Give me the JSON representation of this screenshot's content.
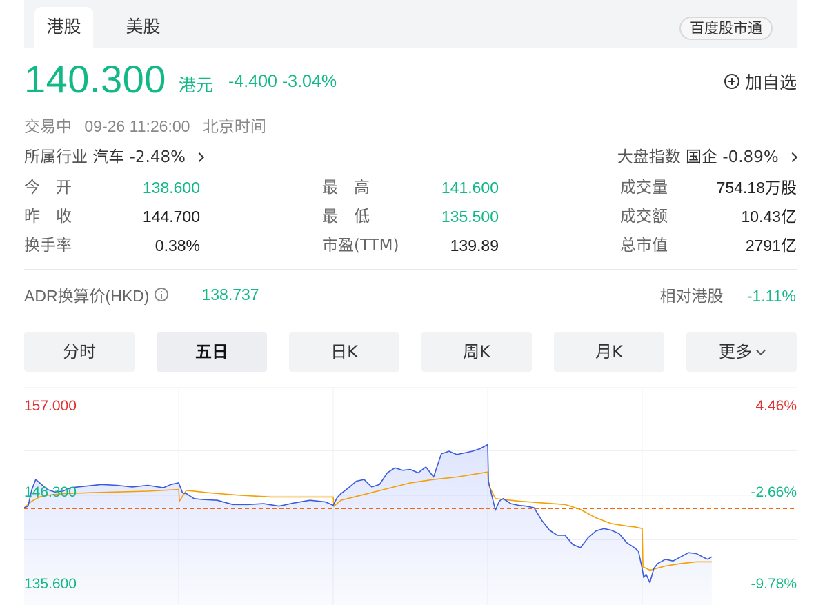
{
  "tabs": {
    "hk": "港股",
    "us": "美股",
    "service": "百度股市通"
  },
  "quote": {
    "price": "140.300",
    "currency": "港元",
    "change": "-4.400",
    "change_pct": "-3.04%",
    "add_watchlist": "加自选"
  },
  "status": {
    "state": "交易中",
    "datetime": "09-26 11:26:00",
    "timezone": "北京时间"
  },
  "industry": {
    "label": "所属行业",
    "name": "汽车",
    "change": "-2.48%"
  },
  "index": {
    "label": "大盘指数",
    "name": "国企",
    "change": "-0.89%"
  },
  "stats": {
    "open": {
      "label": "今　开",
      "value": "138.600"
    },
    "prev_close": {
      "label": "昨　收",
      "value": "144.700"
    },
    "turnover_rate": {
      "label": "换手率",
      "value": "0.38%"
    },
    "high": {
      "label": "最　高",
      "value": "141.600"
    },
    "low": {
      "label": "最　低",
      "value": "135.500"
    },
    "pe_ttm": {
      "label": "市盈(TTM)",
      "value": "139.89"
    },
    "volume": {
      "label": "成交量",
      "value": "754.18万股"
    },
    "amount": {
      "label": "成交额",
      "value": "10.43亿"
    },
    "market_cap": {
      "label": "总市值",
      "value": "2791亿"
    }
  },
  "adr": {
    "label": "ADR换算价(HKD)",
    "value": "138.737",
    "relative_label": "相对港股",
    "relative_value": "-1.11%"
  },
  "periods": [
    "分时",
    "五日",
    "日K",
    "周K",
    "月K",
    "更多"
  ],
  "active_period": "五日",
  "colors": {
    "up": "#e03131",
    "down": "#12b886",
    "price_line": "#3b5bdb",
    "avg_line": "#f59f00",
    "prev_close_line": "#f76707"
  },
  "chart_data": {
    "type": "line",
    "y_left_ticks": [
      "157.000",
      "146.300",
      "135.600"
    ],
    "y_right_ticks": [
      "4.46%",
      "-2.66%",
      "-9.78%"
    ],
    "ylim": [
      135.6,
      157.0
    ],
    "prev_close": 144.7,
    "day_boundaries": [
      0.2,
      0.4,
      0.6,
      0.8
    ],
    "series": [
      {
        "role": "price",
        "x": [
          0,
          0.005,
          0.01,
          0.015,
          0.02,
          0.03,
          0.04,
          0.05,
          0.06,
          0.08,
          0.1,
          0.12,
          0.14,
          0.16,
          0.18,
          0.19,
          0.2,
          0.205,
          0.21,
          0.22,
          0.23,
          0.25,
          0.27,
          0.29,
          0.31,
          0.33,
          0.35,
          0.37,
          0.39,
          0.4,
          0.405,
          0.41,
          0.42,
          0.43,
          0.44,
          0.45,
          0.46,
          0.47,
          0.48,
          0.49,
          0.5,
          0.51,
          0.52,
          0.53,
          0.54,
          0.55,
          0.56,
          0.57,
          0.58,
          0.59,
          0.6,
          0.601,
          0.605,
          0.61,
          0.615,
          0.62,
          0.63,
          0.64,
          0.65,
          0.66,
          0.67,
          0.68,
          0.69,
          0.7,
          0.71,
          0.72,
          0.73,
          0.74,
          0.75,
          0.76,
          0.77,
          0.78,
          0.79,
          0.795,
          0.8,
          0.802,
          0.805,
          0.81,
          0.815,
          0.82,
          0.83,
          0.84,
          0.85,
          0.86,
          0.87,
          0.88,
          0.885,
          0.89
        ],
        "y": [
          144.8,
          145.0,
          147.0,
          148.2,
          147.8,
          147.0,
          146.7,
          146.8,
          147.2,
          147.4,
          147.6,
          147.5,
          147.3,
          147.5,
          147.2,
          147.6,
          147.8,
          146.6,
          146.5,
          145.9,
          145.8,
          145.7,
          145.2,
          145.2,
          145.3,
          145.0,
          145.4,
          145.7,
          145.5,
          145.1,
          146.0,
          146.5,
          147.2,
          148.0,
          148.2,
          147.3,
          147.6,
          149.0,
          149.6,
          149.3,
          149.4,
          149.0,
          149.7,
          148.5,
          151.3,
          151.6,
          151.2,
          151.4,
          151.6,
          151.9,
          152.4,
          148.0,
          146.4,
          144.5,
          145.6,
          145.9,
          145.3,
          145.1,
          145.0,
          144.8,
          143.3,
          142.1,
          141.5,
          141.5,
          140.4,
          140.0,
          141.2,
          142.0,
          142.3,
          142.1,
          141.7,
          140.6,
          140.0,
          139.6,
          137.5,
          136.4,
          136.8,
          135.8,
          137.5,
          138.1,
          138.6,
          138.4,
          138.9,
          139.4,
          139.3,
          138.8,
          138.6,
          138.9
        ]
      },
      {
        "role": "average",
        "x": [
          0,
          0.01,
          0.02,
          0.03,
          0.04,
          0.05,
          0.08,
          0.12,
          0.16,
          0.2,
          0.201,
          0.21,
          0.24,
          0.28,
          0.32,
          0.36,
          0.4,
          0.401,
          0.41,
          0.44,
          0.47,
          0.5,
          0.53,
          0.56,
          0.6,
          0.601,
          0.61,
          0.64,
          0.67,
          0.7,
          0.72,
          0.74,
          0.76,
          0.78,
          0.79,
          0.8,
          0.801,
          0.81,
          0.83,
          0.85,
          0.87,
          0.89
        ],
        "y": [
          144.8,
          145.6,
          146.1,
          146.3,
          146.4,
          146.5,
          146.6,
          146.7,
          146.8,
          147.0,
          145.6,
          146.9,
          146.6,
          146.3,
          146.1,
          146.1,
          146.1,
          145.0,
          145.7,
          146.4,
          147.1,
          147.8,
          148.2,
          148.5,
          149.1,
          147.6,
          145.9,
          145.6,
          145.4,
          145.2,
          144.6,
          143.6,
          142.9,
          142.6,
          142.5,
          142.3,
          137.7,
          137.3,
          137.8,
          138.1,
          138.3,
          138.3
        ]
      }
    ]
  }
}
